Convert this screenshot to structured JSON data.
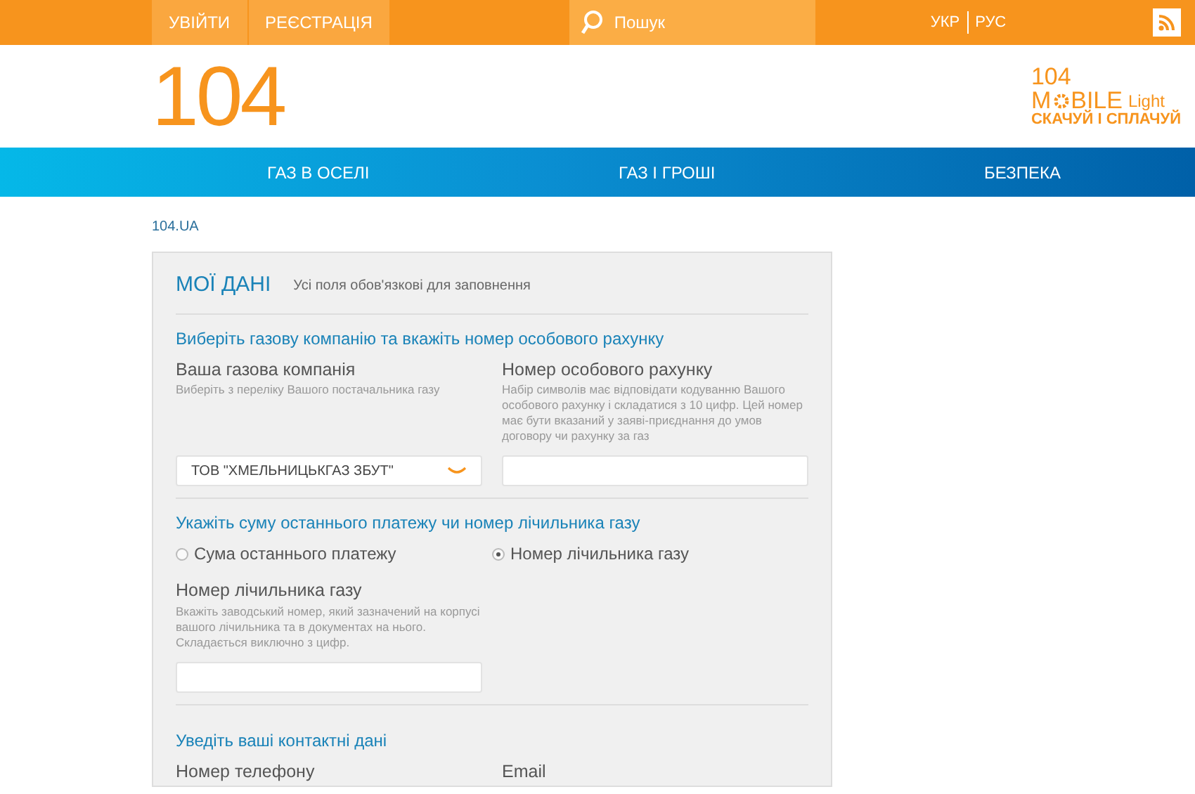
{
  "top_bar": {
    "buttons": [
      "УВІЙТИ",
      "РЕЄСТРАЦІЯ"
    ],
    "search": {
      "placeholder": "Пошук"
    },
    "languages": [
      "УКР",
      "РУС"
    ]
  },
  "header": {
    "logo": "104",
    "mobile_logo": {
      "number": "104",
      "word_start": "M",
      "word_end": "BILE",
      "edition": "Light",
      "slogan": "СКАЧУЙ І СПЛАЧУЙ"
    }
  },
  "nav": [
    "ГАЗ В ОСЕЛІ",
    "ГАЗ І ГРОШІ",
    "БЕЗПЕКА"
  ],
  "breadcrumb": "104.UA",
  "form": {
    "title": "МОЇ ДАНІ",
    "subtitle": "Усі поля обов'язкові для заповнення",
    "sections": [
      {
        "heading": "Виберіть газову компанію та вкажіть номер особового рахунку",
        "fields": [
          {
            "kind": "select",
            "label": "Ваша газова компанія",
            "hint": "Виберіть з переліку Вашого постачальника газу",
            "value": "ТОВ \"ХМЕЛЬНИЦЬКГАЗ ЗБУТ\""
          },
          {
            "kind": "text",
            "label": "Номер особового рахунку",
            "hint": "Набір символів має відповідати кодуванню Вашого особового рахунку і складатися з 10 цифр. Цей номер має бути вказаний у заяві-приєднання до умов договору чи рахунку за газ"
          }
        ]
      },
      {
        "heading": "Укажіть суму останнього платежу чи номер лічильника газу",
        "options": [
          {
            "label": "Сума останнього платежу",
            "selected": false
          },
          {
            "label": "Номер лічильника газу",
            "selected": true
          }
        ],
        "fields": [
          {
            "kind": "text",
            "label": "Номер лічильника газу",
            "hint": "Вкажіть заводський номер, який зазначений на корпусі вашого лічильника та в документах на нього. Складається виключно з цифр."
          }
        ]
      },
      {
        "heading": "Уведіть ваші контактні дані",
        "fields": [
          {
            "kind": "label",
            "label": "Номер телефону"
          },
          {
            "kind": "label",
            "label": "Email"
          }
        ]
      }
    ]
  }
}
